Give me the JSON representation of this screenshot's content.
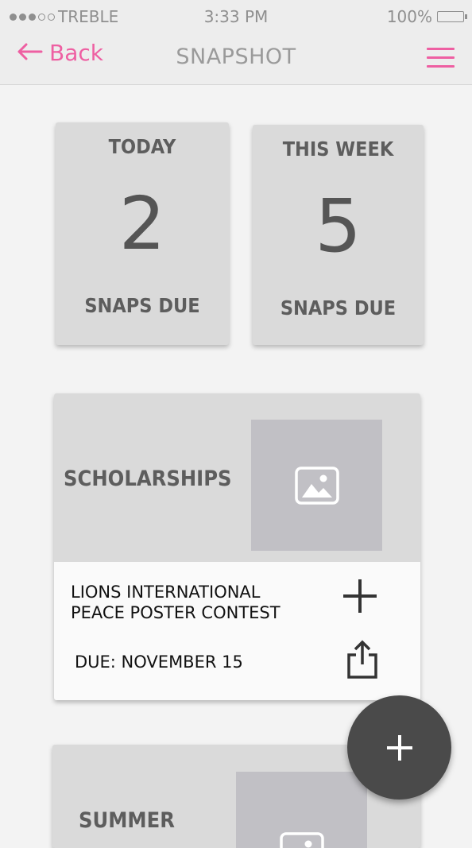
{
  "status_bar": {
    "carrier": "TREBLE",
    "time": "3:33 PM",
    "battery": "100%"
  },
  "nav": {
    "back_label": "Back",
    "title": "SNAPSHOT",
    "back_icon": "arrow-left-icon",
    "menu_icon": "hamburger-menu-icon"
  },
  "stats": [
    {
      "heading": "TODAY",
      "count": "2",
      "footer": "SNAPS DUE"
    },
    {
      "heading": "THIS WEEK",
      "count": "5",
      "footer": "SNAPS DUE"
    }
  ],
  "cards": [
    {
      "category": "SCHOLARSHIPS",
      "name_line1": "LIONS INTERNATIONAL",
      "name_line2": "PEACE POSTER CONTEST",
      "due": "DUE: NOVEMBER 15",
      "image_icon": "image-placeholder-icon",
      "add_icon": "plus-icon",
      "share_icon": "share-icon"
    },
    {
      "category": "SUMMER",
      "image_icon": "image-placeholder-icon"
    }
  ],
  "fab": {
    "icon": "plus-icon"
  },
  "colors": {
    "accent": "#ee5fa2",
    "card_bg": "#dadada",
    "image_bg": "#c1c0c5",
    "fab_bg": "#4a4a4a"
  }
}
